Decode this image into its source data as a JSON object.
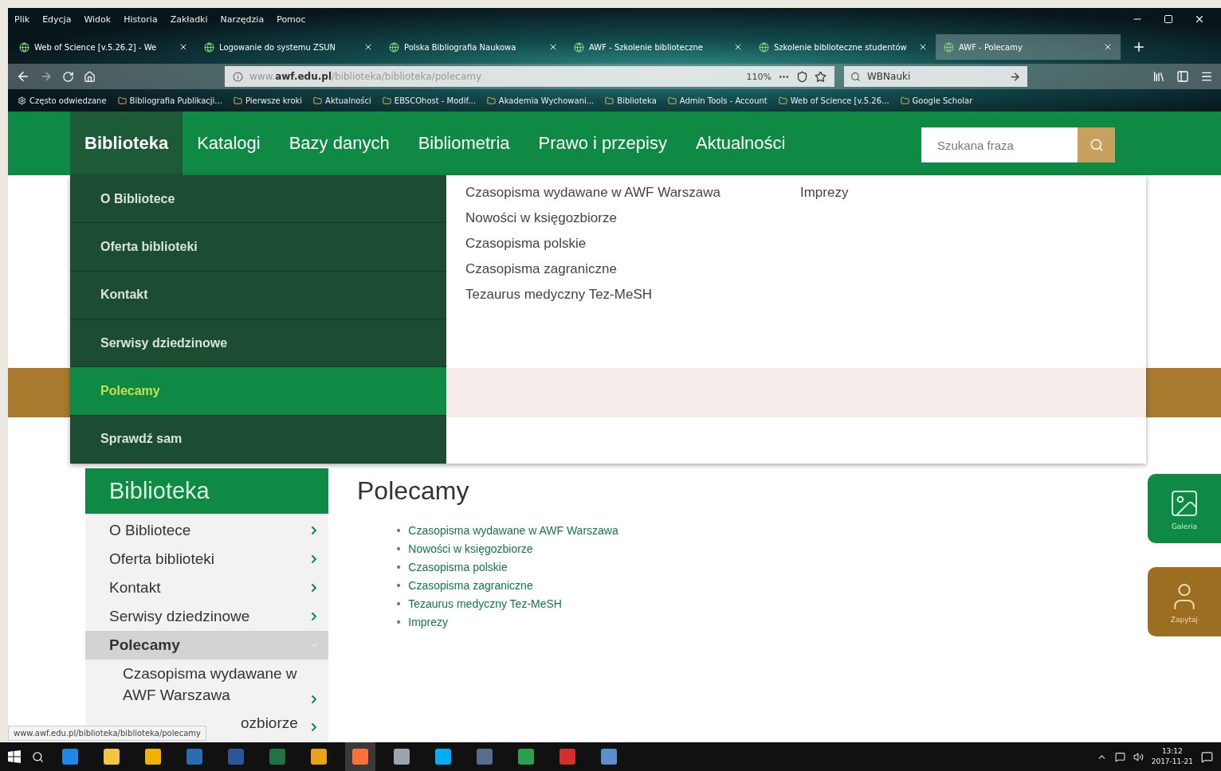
{
  "browser": {
    "menu_bar": [
      "Plik",
      "Edycja",
      "Widok",
      "Historia",
      "Zakładki",
      "Narzędzia",
      "Pomoc"
    ],
    "tabs": [
      {
        "title": "Web of Science [v.5.26.2] - We",
        "selected": false
      },
      {
        "title": "Logowanie do systemu ZSUN",
        "selected": false
      },
      {
        "title": "Polska Bibliografia Naukowa",
        "selected": false
      },
      {
        "title": "AWF - Szkolenie biblioteczne",
        "selected": false
      },
      {
        "title": "Szkolenie biblioteczne studentów",
        "selected": false
      },
      {
        "title": "AWF - Polecamy",
        "selected": true
      }
    ],
    "address": "www.**awf.edu.pl**/biblioteka/biblioteka/polecamy",
    "zoom": "110%",
    "search": "WBNauki",
    "bookmarks": [
      "Często odwiedzane",
      "Bibliografia Publikacji...",
      "Pierwsze kroki",
      "Aktualności",
      "EBSCOhost - Modif...",
      "Akademia Wychowani...",
      "Biblioteka",
      "Admin Tools - Account",
      "Web of Science [v.5.26...",
      "Google Scholar"
    ]
  },
  "site": {
    "nav": [
      {
        "label": "Biblioteka",
        "selected": true
      },
      {
        "label": "Katalogi",
        "selected": false
      },
      {
        "label": "Bazy danych",
        "selected": false
      },
      {
        "label": "Bibliometria",
        "selected": false
      },
      {
        "label": "Prawo i przepisy",
        "selected": false
      },
      {
        "label": "Aktualności",
        "selected": false
      }
    ],
    "search": {
      "placeholder": "Szukana fraza"
    },
    "mega_menu": {
      "items": [
        {
          "label": "O Bibliotece",
          "selected": false
        },
        {
          "label": "Oferta biblioteki",
          "selected": false
        },
        {
          "label": "Kontakt",
          "selected": false
        },
        {
          "label": "Serwisy dziedzinowe",
          "selected": false
        },
        {
          "label": "Polecamy",
          "selected": true
        },
        {
          "label": "Sprawdź sam",
          "selected": false
        }
      ],
      "columns": [
        [
          "Czasopisma wydawane w AWF Warszawa",
          "Nowości w księgozbiorze",
          "Czasopisma polskie",
          "Czasopisma zagraniczne",
          "Tezaurus medyczny Tez-MeSH"
        ],
        [
          "Imprezy"
        ]
      ]
    },
    "sidebar": {
      "title": "Biblioteka",
      "items": [
        {
          "label": "O Bibliotece",
          "selected": false
        },
        {
          "label": "Oferta biblioteki",
          "selected": false
        },
        {
          "label": "Kontakt",
          "selected": false
        },
        {
          "label": "Serwisy dziedzinowe",
          "selected": false
        },
        {
          "label": "Polecamy",
          "selected": true
        }
      ],
      "subitems": [
        "Czasopisma wydawane w AWF Warszawa",
        "ozbiorze"
      ]
    },
    "content": {
      "title": "Polecamy",
      "bullet": "•",
      "links": [
        "Czasopisma wydawane w AWF Warszawa",
        "Nowości w księgozbiorze",
        "Czasopisma polskie",
        "Czasopisma zagraniczne",
        "Tezaurus medyczny Tez-MeSH",
        "Imprezy"
      ]
    },
    "side_buttons": [
      {
        "kind": "gallery",
        "label": "Galeria"
      },
      {
        "kind": "ask",
        "label": "Zapytaj"
      }
    ],
    "status_url": "www.awf.edu.pl/biblioteka/biblioteka/polecamy"
  },
  "taskbar": {
    "apps": [
      {
        "color": "#1e88e5",
        "selected": false
      },
      {
        "color": "#f4c542",
        "selected": false
      },
      {
        "color": "#f0b400",
        "selected": false
      },
      {
        "color": "#2b6cb0",
        "selected": false
      },
      {
        "color": "#2b579a",
        "selected": false
      },
      {
        "color": "#217346",
        "selected": false
      },
      {
        "color": "#e8a317",
        "selected": false
      },
      {
        "color": "#ff7139",
        "selected": true
      },
      {
        "color": "#9aa5b1",
        "selected": false
      },
      {
        "color": "#00aff0",
        "selected": false
      },
      {
        "color": "#5a6b8c",
        "selected": false
      },
      {
        "color": "#2e9e4f",
        "selected": false
      },
      {
        "color": "#d32f2f",
        "selected": false
      },
      {
        "color": "#5b8fc9",
        "selected": false
      }
    ],
    "time": "13:12",
    "date": "2017-11-21"
  }
}
